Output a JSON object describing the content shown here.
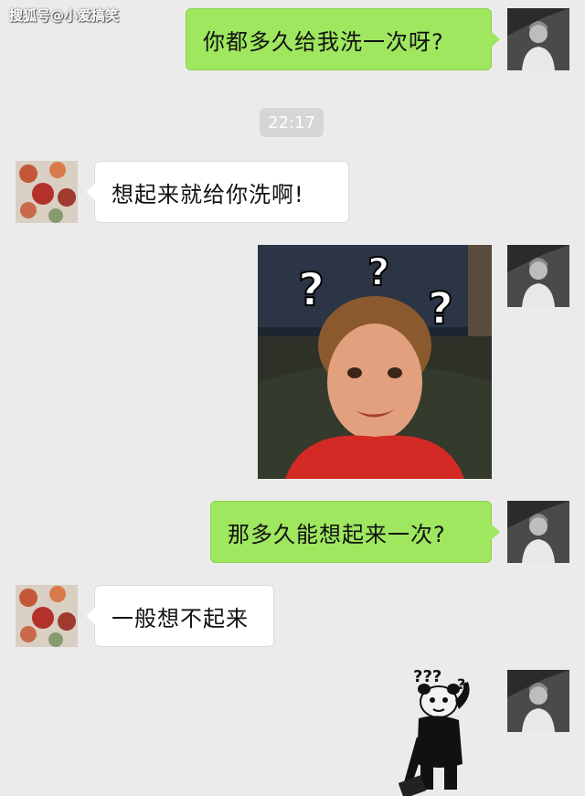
{
  "watermark": "搜狐号@小爱搞笑",
  "timestamp": "22:17",
  "messages": [
    {
      "from": "me",
      "text": "你都多久给我洗一次呀?"
    },
    {
      "from": "other",
      "text": "想起来就给你洗啊!"
    },
    {
      "from": "me",
      "image": "confused-kid-meme"
    },
    {
      "from": "me",
      "text": "那多久能想起来一次?"
    },
    {
      "from": "other",
      "text": "一般想不起来"
    },
    {
      "from": "me",
      "image": "panda-question-marks-meme"
    }
  ],
  "meme": {
    "question_marks": "???",
    "kid_marks": "?"
  },
  "colors": {
    "background": "#ebebeb",
    "outgoing_bubble": "#9ee75f",
    "incoming_bubble": "#ffffff"
  }
}
